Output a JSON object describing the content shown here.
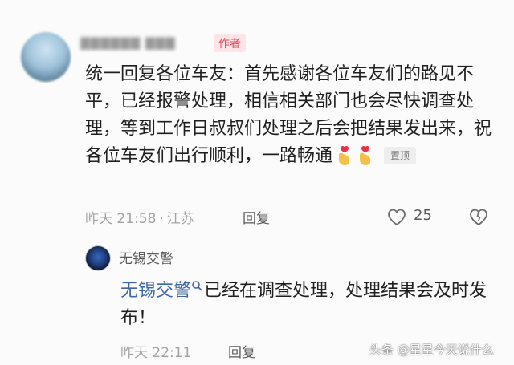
{
  "comment": {
    "author_badge": "作者",
    "text": "统一回复各位车友：首先感谢各位车友们的路见不平，已经报警处理，相信相关部门也会尽快调查处理，等到工作日叔叔们处理之后会把结果发出来，祝各位车友们出行顺利，一路畅通",
    "pin_label": "置顶",
    "time": "昨天 21:58",
    "separator": "·",
    "location": "江苏",
    "reply_label": "回复",
    "like_count": "25",
    "icons": [
      "like-heart-icon",
      "dislike-heart-icon",
      "hand-heart-emoji-icon"
    ],
    "colors": {
      "author_badge_bg": "#fde4e7",
      "author_badge_text": "#e64a5c",
      "mention": "#3e66a8"
    }
  },
  "reply": {
    "username": "无锡交警",
    "mention": "无锡交警",
    "text": "已经在调查处理，处理结果会及时发布！",
    "time": "昨天 22:11",
    "reply_label": "回复"
  },
  "watermark": "头条 @星星今天说什么"
}
